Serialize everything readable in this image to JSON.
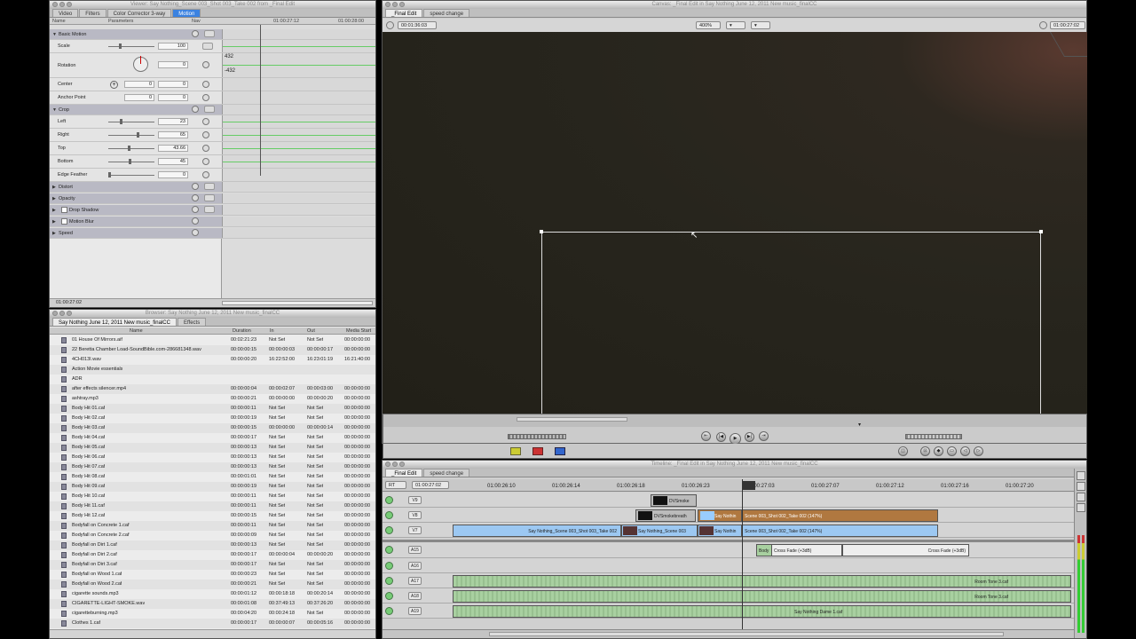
{
  "viewer": {
    "title": "Viewer: Say Nothing_Scene 003_Shot 003_Take 002 from _Final Edit",
    "tabs": [
      "Video",
      "Filters",
      "Color Corrector 3-way",
      "Motion"
    ],
    "active_tab": "Motion",
    "col_name": "Name",
    "col_params": "Parameters",
    "col_nav": "Nav",
    "ruler": [
      "01:00:27:12",
      "01:00:28:00"
    ],
    "kf_values": [
      "432",
      "-432"
    ],
    "timecode": "01:00:27:02",
    "rows": {
      "basic_motion": "Basic Motion",
      "scale": {
        "label": "Scale",
        "value": "100"
      },
      "rotation": {
        "label": "Rotation",
        "value": "0"
      },
      "center": {
        "label": "Center",
        "x": "0",
        "y": "0"
      },
      "anchor": {
        "label": "Anchor Point",
        "x": "0",
        "y": "0"
      },
      "crop": "Crop",
      "left": {
        "label": "Left",
        "value": "23"
      },
      "right": {
        "label": "Right",
        "value": "65"
      },
      "top": {
        "label": "Top",
        "value": "43.66"
      },
      "bottom": {
        "label": "Bottom",
        "value": "45"
      },
      "feather": {
        "label": "Edge Feather",
        "value": "0"
      },
      "distort": "Distort",
      "opacity": "Opacity",
      "drop_shadow": "Drop Shadow",
      "motion_blur": "Motion Blur",
      "speed": "Speed"
    }
  },
  "browser": {
    "title": "Browser: Say Nothing June 12, 2011 New music_finalCC",
    "tabs": [
      "Say Nothing June 12, 2011 New music_finalCC",
      "Effects"
    ],
    "cols": [
      "Name",
      "Duration",
      "In",
      "Out",
      "Media Start"
    ],
    "items": [
      [
        "01 House Of Mirrors.aif",
        "00:02:21:23",
        "Not Set",
        "Not Set",
        "00:00:00:00"
      ],
      [
        "22 Beretta Chamber Load-SoundBible.com-286681348.wav",
        "00:00:00:15",
        "00:00:00:03",
        "00:00:00:17",
        "00:00:00:00"
      ],
      [
        "4CH013I.wav",
        "00:00:00:20",
        "16:22:52:00",
        "16:23:01:19",
        "16:21:40:00"
      ],
      [
        "Action Movie essentials",
        "",
        "",
        "",
        ""
      ],
      [
        "ADR",
        "",
        "",
        "",
        ""
      ],
      [
        "after effects silencer.mp4",
        "00:00:00:04",
        "00:00:02:07",
        "00:00:03:00",
        "00:00:00:00"
      ],
      [
        "ashtray.mp3",
        "00:00:00:21",
        "00:00:00:00",
        "00:00:00:20",
        "00:00:00:00"
      ],
      [
        "Body Hit 01.caf",
        "00:00:00:11",
        "Not Set",
        "Not Set",
        "00:00:00:00"
      ],
      [
        "Body Hit 02.caf",
        "00:00:00:19",
        "Not Set",
        "Not Set",
        "00:00:00:00"
      ],
      [
        "Body Hit 03.caf",
        "00:00:00:15",
        "00:00:00:00",
        "00:00:00:14",
        "00:00:00:00"
      ],
      [
        "Body Hit 04.caf",
        "00:00:00:17",
        "Not Set",
        "Not Set",
        "00:00:00:00"
      ],
      [
        "Body Hit 05.caf",
        "00:00:00:13",
        "Not Set",
        "Not Set",
        "00:00:00:00"
      ],
      [
        "Body Hit 06.caf",
        "00:00:00:13",
        "Not Set",
        "Not Set",
        "00:00:00:00"
      ],
      [
        "Body Hit 07.caf",
        "00:00:00:13",
        "Not Set",
        "Not Set",
        "00:00:00:00"
      ],
      [
        "Body Hit 08.caf",
        "00:00:01:01",
        "Not Set",
        "Not Set",
        "00:00:00:00"
      ],
      [
        "Body Hit 09.caf",
        "00:00:00:19",
        "Not Set",
        "Not Set",
        "00:00:00:00"
      ],
      [
        "Body Hit 10.caf",
        "00:00:00:11",
        "Not Set",
        "Not Set",
        "00:00:00:00"
      ],
      [
        "Body Hit 11.caf",
        "00:00:00:11",
        "Not Set",
        "Not Set",
        "00:00:00:00"
      ],
      [
        "Body Hit 12.caf",
        "00:00:00:15",
        "Not Set",
        "Not Set",
        "00:00:00:00"
      ],
      [
        "Bodyfall on Concrete 1.caf",
        "00:00:00:11",
        "Not Set",
        "Not Set",
        "00:00:00:00"
      ],
      [
        "Bodyfall on Concrete 2.caf",
        "00:00:00:09",
        "Not Set",
        "Not Set",
        "00:00:00:00"
      ],
      [
        "Bodyfall on Dirt 1.caf",
        "00:00:00:13",
        "Not Set",
        "Not Set",
        "00:00:00:00"
      ],
      [
        "Bodyfall on Dirt 2.caf",
        "00:00:00:17",
        "00:00:00:04",
        "00:00:00:20",
        "00:00:00:00"
      ],
      [
        "Bodyfall on Dirt 3.caf",
        "00:00:00:17",
        "Not Set",
        "Not Set",
        "00:00:00:00"
      ],
      [
        "Bodyfall on Wood 1.caf",
        "00:00:00:23",
        "Not Set",
        "Not Set",
        "00:00:00:00"
      ],
      [
        "Bodyfall on Wood 2.caf",
        "00:00:00:21",
        "Not Set",
        "Not Set",
        "00:00:00:00"
      ],
      [
        "cigarette sounds.mp3",
        "00:00:01:12",
        "00:00:18:18",
        "00:00:20:14",
        "00:00:00:00"
      ],
      [
        "CIGARETTE-LIGHT-SMOKE.wav",
        "00:00:01:08",
        "00:37:49:13",
        "00:37:26:20",
        "00:00:00:00"
      ],
      [
        "cigaretteburning.mp3",
        "00:00:04:20",
        "00:00:24:18",
        "Not Set",
        "00:00:00:00"
      ],
      [
        "Clothes 1.caf",
        "00:00:00:17",
        "00:00:00:07",
        "00:00:05:16",
        "00:00:00:00"
      ]
    ]
  },
  "canvas": {
    "title": "Canvas: _Final Edit in Say Nothing June 12, 2011 New music_finalCC",
    "tabs": [
      "_Final Edit",
      "speed change"
    ],
    "timecode_left": "00:01:36:03",
    "zoom": "400%",
    "timecode_right": "01:00:27:02"
  },
  "timeline": {
    "title": "Timeline: _Final Edit in Say Nothing June 12, 2011 New music_finalCC",
    "tabs": [
      "_Final Edit",
      "speed change"
    ],
    "rt": "RT",
    "timecode": "01:00:27:02",
    "ruler": [
      "01:00:26:10",
      "01:00:26:14",
      "01:00:26:18",
      "01:00:26:23",
      "01:00:27:03",
      "01:00:27:07",
      "01:00:27:12",
      "01:00:27:16",
      "01:00:27:20"
    ],
    "tracks": [
      "V9",
      "V8",
      "V7",
      "A15",
      "A16",
      "A17",
      "A18",
      "A19"
    ],
    "clips": {
      "v9a": "DVSmoke",
      "v8a": "DVSmokebreath",
      "v8b": "Say Nothin",
      "v8c": "Scene 003_Shot 002_Take 002 (147%)",
      "v7a": "Say Nothing_Scene 003_Shot 003_Take 002",
      "v7b": "Say Nothing_Scene 003",
      "v7c": "Say Nothin",
      "v7d": "Scene 003_Shot 002_Take 002 (147%)",
      "a15a": "Body",
      "a15b": "Cross Fade (+3dB)",
      "a15c": "Cross Fade (+3dB)",
      "a17": "Room Tone 3.caf",
      "a18": "Room Tone 3.caf",
      "a19": "Say Nothing Dame 1.caf"
    }
  }
}
